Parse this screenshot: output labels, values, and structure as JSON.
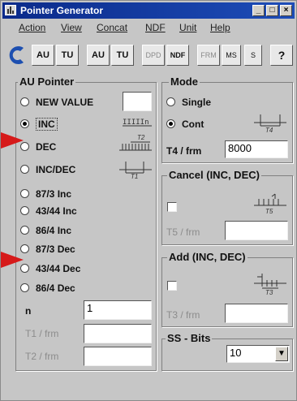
{
  "window": {
    "title": "Pointer Generator",
    "controls": [
      "_",
      "□",
      "×"
    ]
  },
  "menu": [
    "Action",
    "View",
    "Concat",
    "NDF",
    "Unit",
    "Help"
  ],
  "toolbar": {
    "au1": "AU",
    "tu1": "TU",
    "au2": "AU",
    "tu2": "TU",
    "dpd": "DPD",
    "ndf": "NDF",
    "frm": "FRM",
    "ms": "MS",
    "s": "S",
    "help": "?"
  },
  "au_pointer": {
    "title": "AU Pointer",
    "options": [
      {
        "label": "NEW VALUE",
        "selected": false
      },
      {
        "label": "INC",
        "selected": true
      },
      {
        "label": "DEC",
        "selected": false
      },
      {
        "label": "INC/DEC",
        "selected": false
      },
      {
        "label": "87/3 Inc",
        "selected": false
      },
      {
        "label": "43/44 Inc",
        "selected": false
      },
      {
        "label": "86/4 Inc",
        "selected": false
      },
      {
        "label": "87/3 Dec",
        "selected": false
      },
      {
        "label": "43/44 Dec",
        "selected": false
      },
      {
        "label": "86/4 Dec",
        "selected": false
      }
    ],
    "n_label": "n",
    "n_value": "1",
    "t1_label": "T1 / frm",
    "t1_value": "",
    "t2_label": "T2 / frm",
    "t2_value": "",
    "diagram_inc": "IIIIIn",
    "diagram_t2": "T2",
    "diagram_t1": "T1"
  },
  "mode": {
    "title": "Mode",
    "single": "Single",
    "cont": "Cont",
    "selected": "Cont",
    "t4_label": "T4 / frm",
    "t4_value": "8000",
    "diagram_t4": "T4"
  },
  "cancel": {
    "title": "Cancel (INC, DEC)",
    "t5_label": "T5 / frm",
    "t5_value": "",
    "diagram_t5": "T5"
  },
  "add": {
    "title": "Add (INC, DEC)",
    "t3_label": "T3 / frm",
    "t3_value": "",
    "diagram_t3": "T3"
  },
  "ss_bits": {
    "title": "SS - Bits",
    "value": "10",
    "dropdown": "▼"
  },
  "colors": {
    "title_bar": "#0a2a8a",
    "annotation_arrow": "#d61a1a",
    "window_bg": "#c6c6c6"
  }
}
